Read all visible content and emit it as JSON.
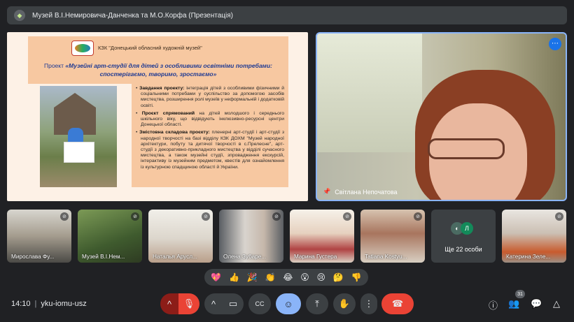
{
  "meeting": {
    "title": "Музей В.І.Немировича-Данченка та М.О.Корфа (Презентація)",
    "time": "14:10",
    "code": "yku-iomu-usz",
    "participants_count": "31"
  },
  "slide": {
    "org": "КЗК \"Донецький обласний художній музей\"",
    "project_prefix": "Проект ",
    "project_title": "«Музейні арт-студії для дітей з особливими освітніми потребами: спостерігаємо, творимо, зростаємо»",
    "bullets": [
      {
        "head": "Завдання проекту:",
        "text": " інтеграція дітей з особливими фізичними й соціальними потребами у суспільство за допомогою засобів мистецтва, розширення ролі музеїв у неформальній і додатковій освіті."
      },
      {
        "head": "Проєкт спрямований",
        "text": " на дітей молодшого і середнього шкільного віку, що відвідують інклюзивно-ресурсні центри Донецької області."
      },
      {
        "head": "Змістовна складова проєкту:",
        "text": " пленерні арт-студії і арт-студії з народної творчості на базі відділу КЗК ДОХМ \"Музей народної архітектури, побуту та дитячої творчості в с.Прелесне\", арт-студії з декоративно-прикладного мистецтва у відділі сучасного мистецтва, а також музейні студії, зпровадження екскурсій, інтерактиву із музейним предметом, квестів для ознайомлення із культурною спадщиною області й України."
      }
    ]
  },
  "speaker": {
    "name": "Світлана Непочатова",
    "more_icon": "⋯"
  },
  "participants": [
    {
      "name": "Мирослава Фу..."
    },
    {
      "name": "Музей В.І.Нем..."
    },
    {
      "name": "Наталья Арусл..."
    },
    {
      "name": "Олена Зубаре..."
    },
    {
      "name": "Марина Густера"
    },
    {
      "name": "Tatiana Kostyu..."
    },
    {
      "name": "Катерина Зеле..."
    }
  ],
  "more_tile": {
    "label": "Ще 22 особи",
    "avatar_letter": "Л"
  },
  "reactions": [
    "💖",
    "👍",
    "🎉",
    "👏",
    "😂",
    "😮",
    "😢",
    "🤔",
    "👎"
  ],
  "icons": {
    "chevron": "^",
    "mic_off": "🎙",
    "chevron2": "^",
    "camera": "▭",
    "captions": "CC",
    "emoji": "☺",
    "present": "⤒",
    "hand": "✋",
    "more": "⋮",
    "hangup": "☎",
    "info": "ⓘ",
    "people": "👥",
    "chat": "💬",
    "activities": "△"
  },
  "colors": {
    "accent": "#8ab4f8",
    "hangup": "#ea4335",
    "background": "#202124"
  }
}
